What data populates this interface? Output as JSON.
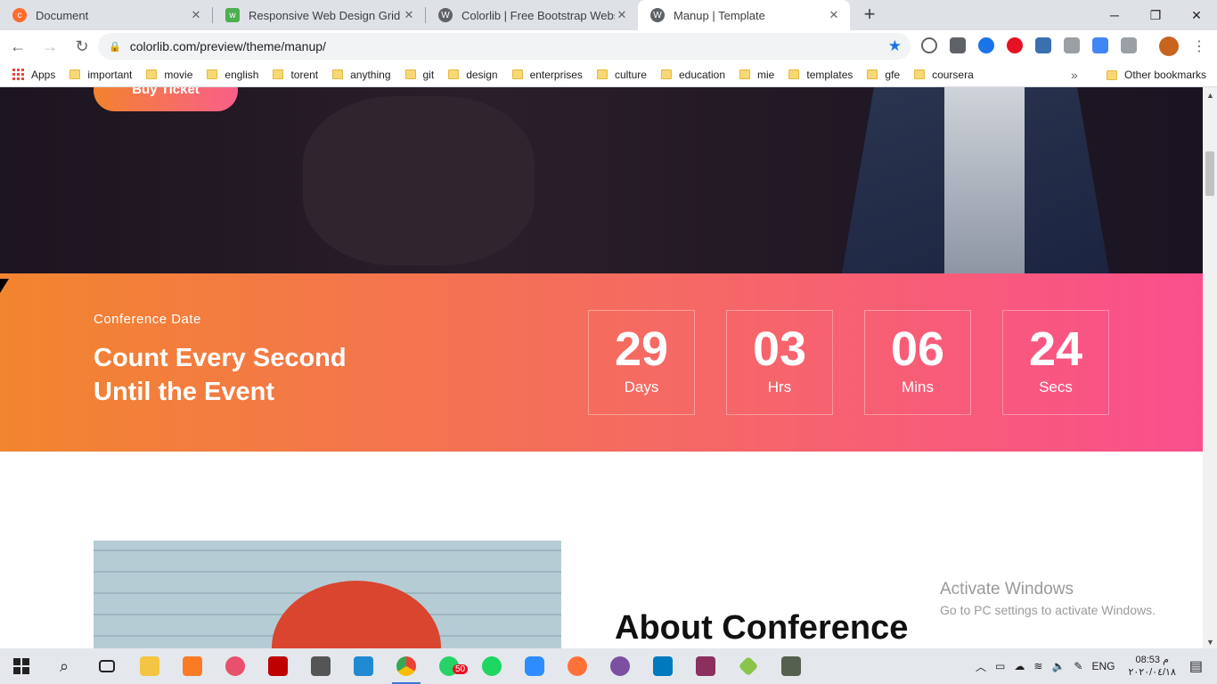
{
  "tabs": [
    {
      "title": "Document",
      "icon": "cpanel-icon",
      "icon_color": "#ff6c2c"
    },
    {
      "title": "Responsive Web Design Grid",
      "icon": "w3schools-icon",
      "icon_color": "#4caf50"
    },
    {
      "title": "Colorlib | Free Bootstrap Website",
      "icon": "wordpress-icon",
      "icon_color": "#5f6368"
    },
    {
      "title": "Manup | Template",
      "icon": "wordpress-icon",
      "icon_color": "#5f6368"
    }
  ],
  "window": {
    "minimize": "─",
    "maximize": "❐",
    "close": "✕",
    "new_tab": "+"
  },
  "toolbar": {
    "url": "colorlib.com/preview/theme/manup/",
    "back": "←",
    "forward": "→",
    "reload": "↻",
    "star": "★",
    "menu": "⋮"
  },
  "bookmarks": {
    "apps": "Apps",
    "items": [
      "important",
      "movie",
      "english",
      "torent",
      "anything",
      "git",
      "design",
      "enterprises",
      "culture",
      "education",
      "mie",
      "templates",
      "gfe",
      "coursera"
    ],
    "more": "»",
    "other": "Other bookmarks"
  },
  "page": {
    "buy_ticket": "Buy Ticket",
    "countdown": {
      "subtitle": "Conference Date",
      "title_line1": "Count Every Second",
      "title_line2": "Until the Event",
      "units": [
        {
          "value": "29",
          "label": "Days"
        },
        {
          "value": "03",
          "label": "Hrs"
        },
        {
          "value": "06",
          "label": "Mins"
        },
        {
          "value": "24",
          "label": "Secs"
        }
      ]
    },
    "about_title": "About Conference"
  },
  "overlay": {
    "activate_title": "Activate Windows",
    "activate_sub": "Go to PC settings to activate Windows."
  },
  "taskbar": {
    "whatsapp_badge": "50",
    "language": "ENG",
    "time": "08:53 م",
    "date": "٢٠٢٠/٠٤/١٨"
  },
  "colors": {
    "accent_start": "#f2852f",
    "accent_end": "#fa4f8d",
    "chrome_blue": "#1a73e8"
  }
}
